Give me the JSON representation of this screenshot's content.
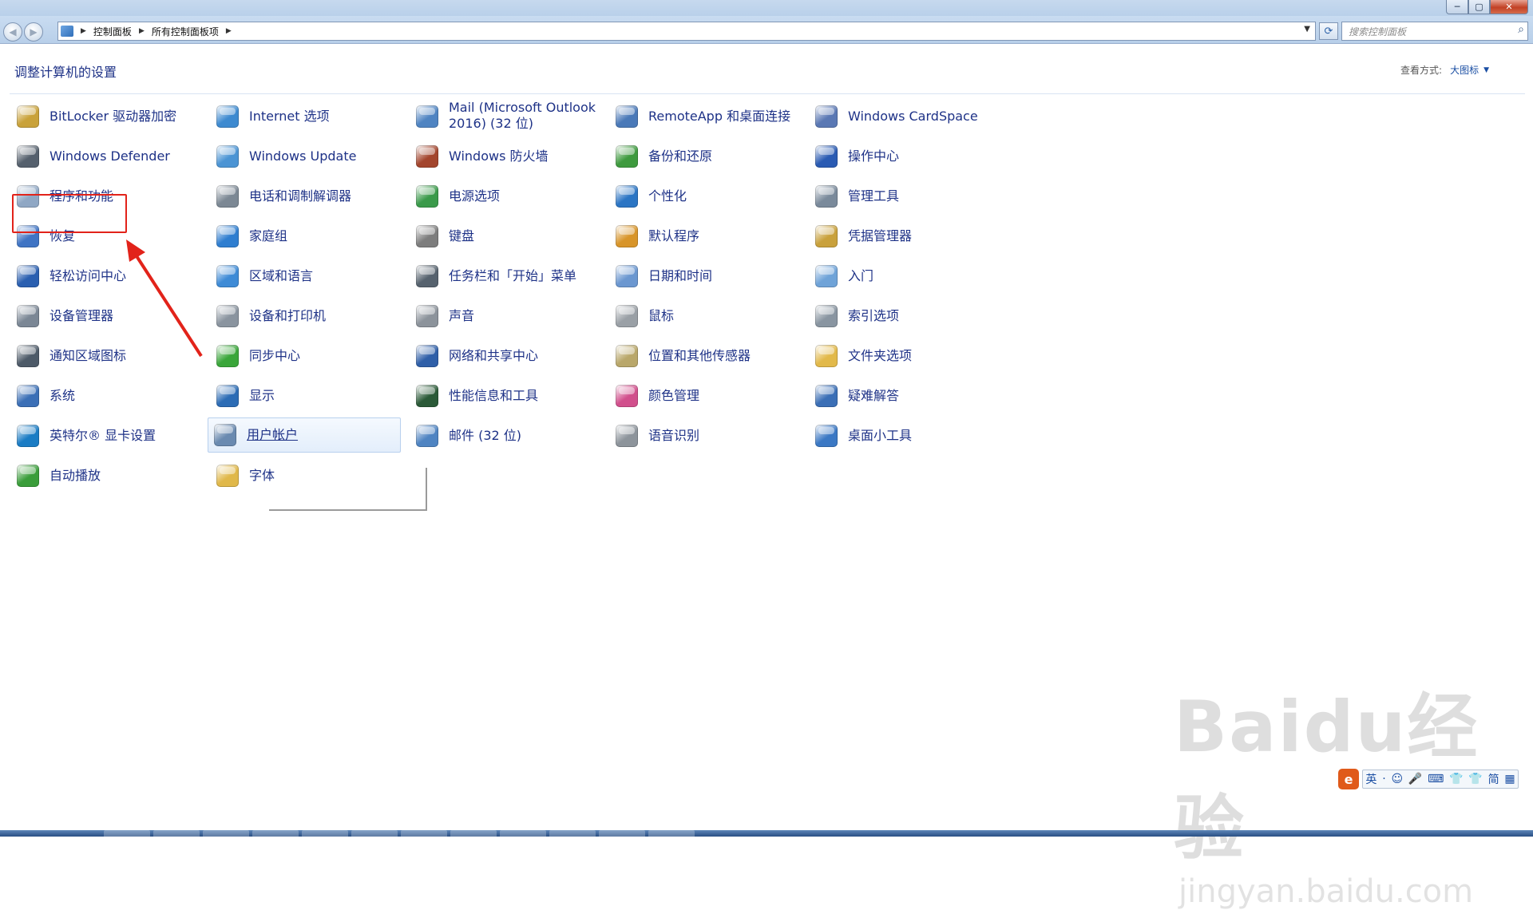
{
  "window": {
    "title": "",
    "minimize_symbol": "─",
    "maximize_symbol": "▢",
    "close_symbol": "✕"
  },
  "navigation": {
    "back_symbol": "◀",
    "forward_symbol": "▶",
    "breadcrumb": [
      "控制面板",
      "所有控制面板项"
    ],
    "search_placeholder": "搜索控制面板"
  },
  "header": {
    "title": "调整计算机的设置",
    "view_by_label": "查看方式:",
    "view_by_value": "大图标"
  },
  "columns": [
    [
      {
        "name": "bitlocker",
        "label": "BitLocker 驱动器加密",
        "icon": "bitlocker-icon",
        "color": "#c9a23a"
      },
      {
        "name": "windows-defender",
        "label": "Windows Defender",
        "icon": "defender-icon",
        "color": "#55606d"
      },
      {
        "name": "programs-features",
        "label": "程序和功能",
        "icon": "programs-icon",
        "color": "#8fa7c4"
      },
      {
        "name": "recovery",
        "label": "恢复",
        "icon": "recovery-icon",
        "color": "#3f74c4"
      },
      {
        "name": "ease-of-access",
        "label": "轻松访问中心",
        "icon": "ease-of-access-icon",
        "color": "#2a5fb0"
      },
      {
        "name": "device-manager",
        "label": "设备管理器",
        "icon": "device-manager-icon",
        "color": "#7b8795"
      },
      {
        "name": "notification-icons",
        "label": "通知区域图标",
        "icon": "notification-icon",
        "color": "#4d5a68"
      },
      {
        "name": "system",
        "label": "系统",
        "icon": "system-icon",
        "color": "#3b6fb6"
      },
      {
        "name": "intel-graphics",
        "label": "英特尔® 显卡设置",
        "icon": "intel-icon",
        "color": "#1a7cc4"
      },
      {
        "name": "autoplay",
        "label": "自动播放",
        "icon": "autoplay-icon",
        "color": "#3a9d3a"
      }
    ],
    [
      {
        "name": "internet-options",
        "label": "Internet 选项",
        "icon": "internet-options-icon",
        "color": "#3d8ad0"
      },
      {
        "name": "windows-update",
        "label": "Windows Update",
        "icon": "windows-update-icon",
        "color": "#4b94d4"
      },
      {
        "name": "phone-modem",
        "label": "电话和调制解调器",
        "icon": "phone-icon",
        "color": "#7c8894"
      },
      {
        "name": "homegroup",
        "label": "家庭组",
        "icon": "homegroup-icon",
        "color": "#2f7ed0"
      },
      {
        "name": "region-language",
        "label": "区域和语言",
        "icon": "globe-icon",
        "color": "#3e8bd6"
      },
      {
        "name": "devices-printers",
        "label": "设备和打印机",
        "icon": "printer-icon",
        "color": "#8a949f"
      },
      {
        "name": "sync-center",
        "label": "同步中心",
        "icon": "sync-icon",
        "color": "#3aa63a"
      },
      {
        "name": "display",
        "label": "显示",
        "icon": "display-icon",
        "color": "#2c6cb5"
      },
      {
        "name": "user-accounts",
        "label": "用户帐户",
        "icon": "users-icon",
        "color": "#6a8ab0"
      },
      {
        "name": "fonts",
        "label": "字体",
        "icon": "fonts-icon",
        "color": "#e0b84a"
      }
    ],
    [
      {
        "name": "mail-outlook",
        "label": "Mail (Microsoft Outlook 2016) (32 位)",
        "icon": "mail-icon",
        "color": "#4f84c2"
      },
      {
        "name": "windows-firewall",
        "label": "Windows 防火墙",
        "icon": "firewall-icon",
        "color": "#a3452d"
      },
      {
        "name": "power-options",
        "label": "电源选项",
        "icon": "power-icon",
        "color": "#3a9a4a"
      },
      {
        "name": "keyboard",
        "label": "键盘",
        "icon": "keyboard-icon",
        "color": "#7d7d7d"
      },
      {
        "name": "taskbar-start",
        "label": "任务栏和「开始」菜单",
        "icon": "taskbar-icon",
        "color": "#56626e"
      },
      {
        "name": "sound",
        "label": "声音",
        "icon": "speaker-icon",
        "color": "#8c939b"
      },
      {
        "name": "network-sharing",
        "label": "网络和共享中心",
        "icon": "network-icon",
        "color": "#2f5fa8"
      },
      {
        "name": "performance",
        "label": "性能信息和工具",
        "icon": "performance-icon",
        "color": "#2b5a38"
      },
      {
        "name": "mail-32",
        "label": "邮件 (32 位)",
        "icon": "mail-icon",
        "color": "#4f84c2"
      }
    ],
    [
      {
        "name": "remoteapp",
        "label": "RemoteApp 和桌面连接",
        "icon": "remoteapp-icon",
        "color": "#4a79b8"
      },
      {
        "name": "backup-restore",
        "label": "备份和还原",
        "icon": "backup-icon",
        "color": "#3e9a3e"
      },
      {
        "name": "personalization",
        "label": "个性化",
        "icon": "personalization-icon",
        "color": "#2b75c4"
      },
      {
        "name": "default-programs",
        "label": "默认程序",
        "icon": "default-programs-icon",
        "color": "#d8952a"
      },
      {
        "name": "date-time",
        "label": "日期和时间",
        "icon": "calendar-icon",
        "color": "#6b97d0"
      },
      {
        "name": "mouse",
        "label": "鼠标",
        "icon": "mouse-icon",
        "color": "#9aa0a6"
      },
      {
        "name": "location-sensors",
        "label": "位置和其他传感器",
        "icon": "sensor-icon",
        "color": "#b9a76a"
      },
      {
        "name": "color-management",
        "label": "颜色管理",
        "icon": "color-icon",
        "color": "#d14f8c"
      },
      {
        "name": "speech-recognition",
        "label": "语音识别",
        "icon": "microphone-icon",
        "color": "#8d949b"
      }
    ],
    [
      {
        "name": "cardspace",
        "label": "Windows CardSpace",
        "icon": "cardspace-icon",
        "color": "#5a78b4"
      },
      {
        "name": "action-center",
        "label": "操作中心",
        "icon": "flag-icon",
        "color": "#2a5bb3"
      },
      {
        "name": "admin-tools",
        "label": "管理工具",
        "icon": "admin-tools-icon",
        "color": "#7a8a9b"
      },
      {
        "name": "credential-manager",
        "label": "凭据管理器",
        "icon": "credential-icon",
        "color": "#c9a13c"
      },
      {
        "name": "getting-started",
        "label": "入门",
        "icon": "getting-started-icon",
        "color": "#6fa3d8"
      },
      {
        "name": "indexing-options",
        "label": "索引选项",
        "icon": "magnifier-icon",
        "color": "#8995a1"
      },
      {
        "name": "folder-options",
        "label": "文件夹选项",
        "icon": "folder-icon",
        "color": "#e2b94a"
      },
      {
        "name": "troubleshooting",
        "label": "疑难解答",
        "icon": "troubleshoot-icon",
        "color": "#3b6fb6"
      },
      {
        "name": "desktop-gadgets",
        "label": "桌面小工具",
        "icon": "gadgets-icon",
        "color": "#3b78c4"
      }
    ]
  ],
  "hovered_item": "user-accounts",
  "annotation": {
    "target": "programs-features",
    "color": "#e2231a"
  },
  "watermark": {
    "brand": "Baidu经验",
    "url": "jingyan.baidu.com"
  },
  "ime": {
    "logo": "e",
    "buttons": [
      "英",
      "·",
      "☺",
      "🎤",
      "⌨",
      "👕",
      "👕",
      "简",
      "▦"
    ]
  }
}
